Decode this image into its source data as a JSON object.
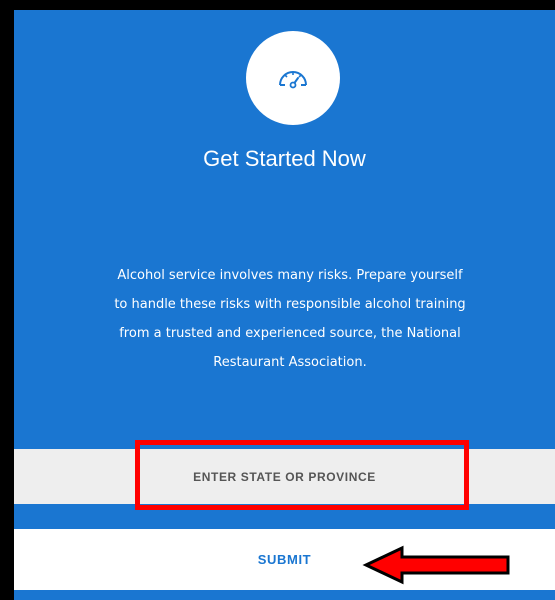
{
  "hero": {
    "icon": "speedometer-icon",
    "title": "Get Started Now",
    "description": "Alcohol service involves many risks. Prepare yourself to handle these risks with responsible alcohol training from a trusted and experienced source, the National Restaurant Association."
  },
  "form": {
    "state_placeholder": "ENTER STATE OR PROVINCE",
    "state_value": "",
    "submit_label": "SUBMIT"
  },
  "annotations": {
    "highlight_color": "#ff0000",
    "arrow_fill": "#ff0000",
    "arrow_stroke": "#000000"
  },
  "colors": {
    "panel_background": "#1a76d1",
    "field_background": "#eeeeee",
    "submit_text": "#1a76d1"
  }
}
